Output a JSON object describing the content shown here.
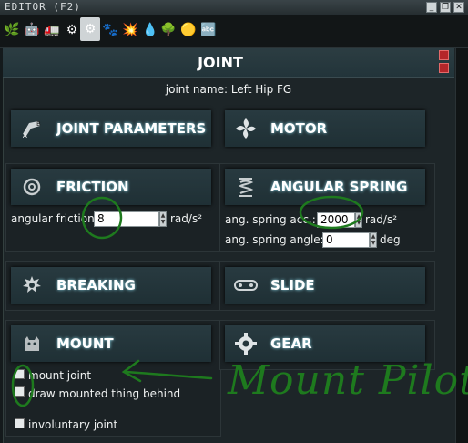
{
  "window": {
    "title": "EDITOR (F2)",
    "controls": [
      "_",
      "❐",
      "✕"
    ]
  },
  "toolbar": {
    "tools": [
      "🌿",
      "🤖",
      "🚛",
      "⚙",
      "⚙",
      "🐾",
      "💥",
      "💧",
      "🌳",
      "🟡",
      "🔤"
    ],
    "selected_index": 4
  },
  "panel": {
    "title": "JOINT",
    "joint_name": "joint name: Left Hip FG"
  },
  "sections": {
    "joint_parameters": "JOINT PARAMETERS",
    "motor": "MOTOR",
    "friction": "FRICTION",
    "angular_spring": "ANGULAR SPRING",
    "breaking": "BREAKING",
    "slide": "SLIDE",
    "mount": "MOUNT",
    "gear": "GEAR"
  },
  "friction": {
    "label": "angular friction:",
    "value": "8",
    "unit": "rad/s²"
  },
  "angular_spring": {
    "accel_label": "ang. spring acc.:",
    "accel_value": "2000",
    "accel_unit": "rad/s²",
    "angle_label": "ang. spring angle:",
    "angle_value": "0",
    "angle_unit": "deg"
  },
  "mount": {
    "mount_joint": "mount joint",
    "draw_behind": "draw mounted thing behind",
    "involuntary": "involuntary joint"
  },
  "annotation": {
    "handwritten": "Mount Pilot",
    "color": "#1e7a1e"
  }
}
